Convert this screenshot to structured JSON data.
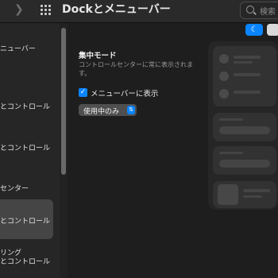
{
  "toolbar": {
    "title": "Dockとメニューバー",
    "search_placeholder": "検索",
    "chevron_icon": "chevron-right-icon",
    "grid_icon": "grid-icon"
  },
  "sidebar": {
    "items": [
      {
        "label": "ニューバー",
        "selected": false
      },
      {
        "label": "",
        "selected": false
      },
      {
        "label": "とコントロール",
        "selected": false
      },
      {
        "label": "とコントロール",
        "selected": false
      },
      {
        "label": "センター",
        "selected": false
      },
      {
        "label": "とコントロール",
        "selected": true
      },
      {
        "label": "リング",
        "selected": false
      },
      {
        "label": "とコントロール",
        "selected": false
      }
    ]
  },
  "section": {
    "title": "集中モード",
    "description": "コントロールセンターに常に表示されます。",
    "checkbox_label": "メニューバーに表示",
    "checkbox_checked": true,
    "popup_value": "使用中のみ"
  },
  "colors": {
    "accent": "#0a84ff",
    "background": "#1e1e1e",
    "sidebar": "#262626"
  }
}
